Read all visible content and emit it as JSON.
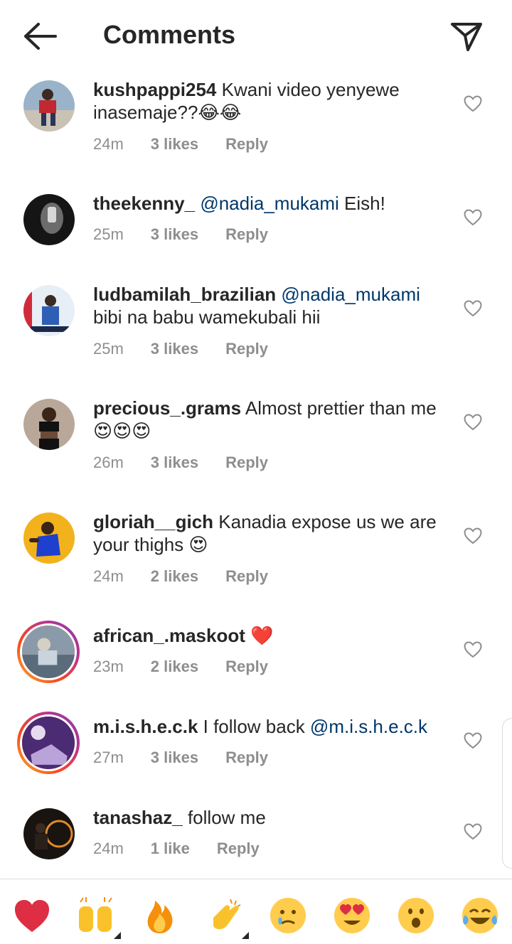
{
  "header": {
    "title": "Comments"
  },
  "comments": [
    {
      "username": "kushpappi254",
      "text_before": " Kwani video yenyewe inasemaje??",
      "mention": "",
      "text_after": "",
      "emojis": "😂😂",
      "time": "24m",
      "likes": "3 likes",
      "reply": "Reply"
    },
    {
      "username": "theekenny_",
      "text_before": " ",
      "mention": "@nadia_mukami",
      "text_after": " Eish!",
      "emojis": "",
      "time": "25m",
      "likes": "3 likes",
      "reply": "Reply"
    },
    {
      "username": "ludbamilah_brazilian",
      "text_before": " ",
      "mention": "@nadia_mukami",
      "text_after": " bibi na babu wamekubali hii",
      "emojis": "",
      "time": "25m",
      "likes": "3 likes",
      "reply": "Reply"
    },
    {
      "username": "precious_.grams",
      "text_before": " Almost prettier than me",
      "mention": "",
      "text_after": "",
      "emojis": "😍😍😍",
      "time": "26m",
      "likes": "3 likes",
      "reply": "Reply"
    },
    {
      "username": "gloriah__gich",
      "text_before": " Kanadia expose us we are your thighs ",
      "mention": "",
      "text_after": "",
      "emojis": "😍",
      "time": "24m",
      "likes": "2 likes",
      "reply": "Reply"
    },
    {
      "username": "african_.maskoot",
      "text_before": " ",
      "mention": "",
      "text_after": "",
      "emojis": "❤️",
      "time": "23m",
      "likes": "2 likes",
      "reply": "Reply"
    },
    {
      "username": "m.i.s.h.e.c.k",
      "text_before": " I follow back ",
      "mention": "@m.i.s.h.e.c.k",
      "text_after": "",
      "emojis": "",
      "time": "27m",
      "likes": "3 likes",
      "reply": "Reply"
    },
    {
      "username": "tanashaz_",
      "text_before": " follow me",
      "mention": "",
      "text_after": "",
      "emojis": "",
      "time": "24m",
      "likes": "1 like",
      "reply": "Reply"
    }
  ],
  "reaction_bar": {
    "emojis": [
      "red-heart",
      "raising-hands",
      "fire",
      "clapping-hands",
      "sad-tear",
      "heart-eyes",
      "surprised",
      "tears-of-joy"
    ]
  },
  "colors": {
    "text": "#262626",
    "secondary": "#8e8e8e",
    "mention": "#00376b",
    "heart": "#e0245e"
  }
}
